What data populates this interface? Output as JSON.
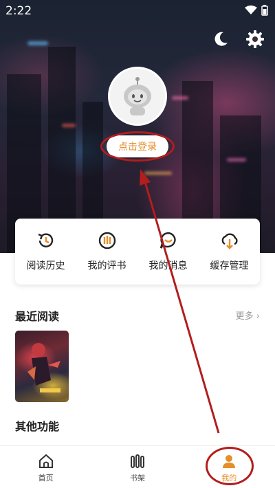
{
  "status": {
    "time": "2:22"
  },
  "header": {
    "login_label": "点击登录"
  },
  "quick_actions": [
    {
      "label": "阅读历史",
      "icon": "history-icon"
    },
    {
      "label": "我的评书",
      "icon": "review-icon"
    },
    {
      "label": "我的消息",
      "icon": "message-icon"
    },
    {
      "label": "缓存管理",
      "icon": "download-icon"
    }
  ],
  "recent": {
    "title": "最近阅读",
    "more_label": "更多"
  },
  "other": {
    "title": "其他功能"
  },
  "nav": [
    {
      "label": "首页",
      "icon": "home-icon"
    },
    {
      "label": "书架",
      "icon": "bookshelf-icon"
    },
    {
      "label": "我的",
      "icon": "profile-icon"
    }
  ],
  "colors": {
    "accent": "#e48f2b",
    "annotation": "#b21d1d"
  }
}
